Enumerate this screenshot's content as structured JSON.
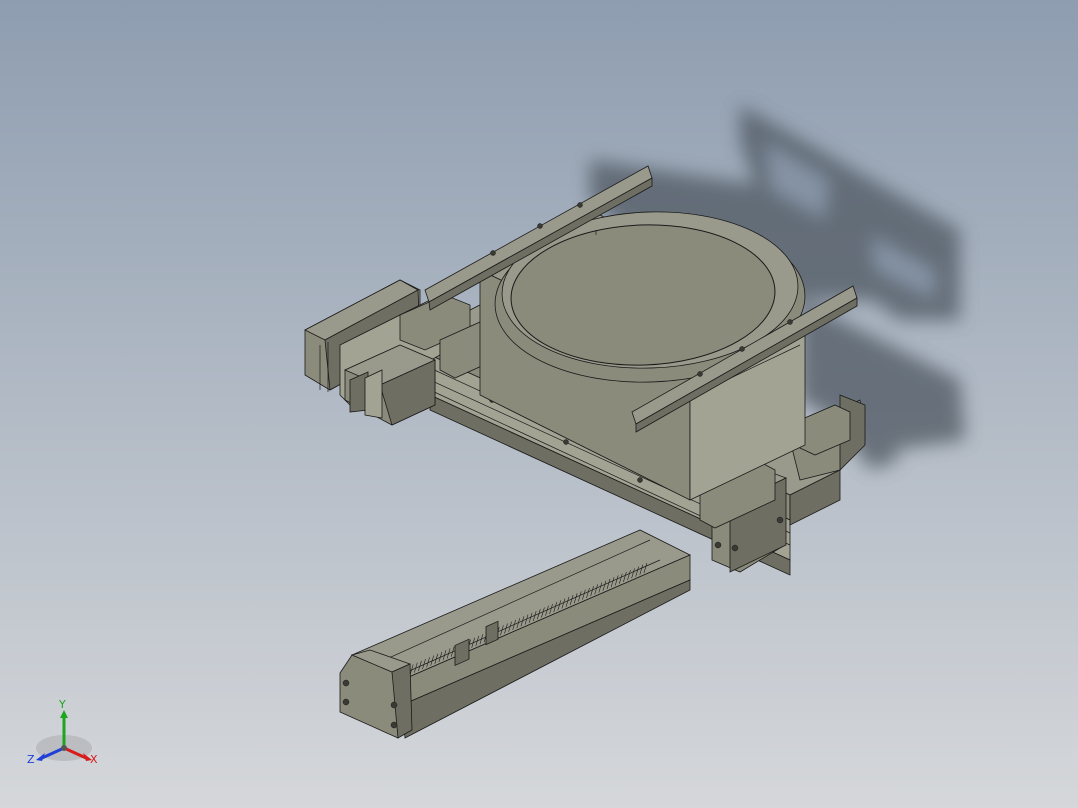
{
  "viewport": {
    "background_top": "#8e9db0",
    "background_bottom": "#d5d7da",
    "model_fill": "#8b8b7c",
    "model_fill_light": "#a3a394",
    "model_fill_dark": "#6e6e62",
    "model_top_fill": "#9a9a8c",
    "edge_color": "#1a1a1a",
    "shadow_color": "#4f5862"
  },
  "triad": {
    "labels": {
      "x": "X",
      "y": "Y",
      "z": "Z"
    },
    "colors": {
      "x": "#d81b1b",
      "y": "#1ea51e",
      "z": "#1f3fd6"
    }
  }
}
